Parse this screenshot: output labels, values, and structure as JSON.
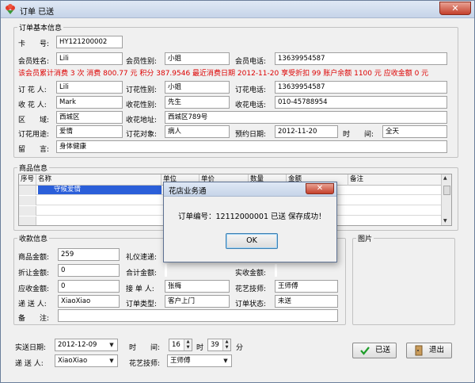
{
  "window": {
    "title": "订单 已送",
    "close": "✕"
  },
  "basic": {
    "title": "订单基本信息",
    "card_label": "卡　　号:",
    "card": "HY121200002",
    "mname_label": "会员姓名:",
    "mname": "Lili",
    "mgender_label": "会员性别:",
    "mgender": "小姐",
    "mphone_label": "会员电话:",
    "mphone": "13639954587",
    "summary": "该会员累计消费 3 次 消费 800.77 元 积分 387.9546 最近消费日期 2012-11-20 享受折扣 99 账户余额 1100 元 应收金额 0 元",
    "buyer_label": "订 花 人:",
    "buyer": "Lili",
    "bgender_label": "订花性别:",
    "bgender": "小姐",
    "bphone_label": "订花电话:",
    "bphone": "13639954587",
    "receiver_label": "收 花 人:",
    "receiver": "Mark",
    "rgender_label": "收花性别:",
    "rgender": "先生",
    "rphone_label": "收花电话:",
    "rphone": "010-45788954",
    "area_label": "区　　域:",
    "area": "西城区",
    "addr_label": "收花地址:",
    "addr": "西城区789号",
    "usage_label": "订花用途:",
    "usage": "爱情",
    "target_label": "订花对象:",
    "target": "病人",
    "date_label": "预约日期:",
    "date": "2012-11-20",
    "time_label": "时　　间:",
    "time": "全天",
    "msg_label": "留　　言:",
    "msg": "身体健康"
  },
  "goods": {
    "title": "商品信息",
    "columns": [
      "序号",
      "名称",
      "单位",
      "单价",
      "数量",
      "金额",
      "备注"
    ],
    "selected_item": "守候爱情"
  },
  "payment": {
    "title": "收款信息",
    "goods_amt_label": "商品金额:",
    "goods_amt": "259",
    "ceremony_label": "礼仪速递:",
    "discount_label": "折让金额:",
    "discount": "0",
    "total_label": "合计金额:",
    "total": "256.41",
    "received_label": "实收金额:",
    "received": "256.41",
    "due_label": "应收金额:",
    "due": "0",
    "handler_label": "接 单 人:",
    "handler": "张梅",
    "florist_label": "花艺技师:",
    "florist": "王师傅",
    "courier_label": "递 送 人:",
    "courier": "XiaoXiao",
    "otype_label": "订单类型:",
    "otype": "客户上门",
    "ostatus_label": "订单状态:",
    "ostatus": "未送",
    "note_label": "备　　注:",
    "note": ""
  },
  "picture": {
    "title": "图片"
  },
  "bottom": {
    "ship_date_label": "实送日期:",
    "ship_date": "2012-12-09",
    "time_label": "时　　间:",
    "hour": "16",
    "hour_unit": "时",
    "minute": "39",
    "minute_unit": "分",
    "courier_label": "递 送 人:",
    "courier": "XiaoXiao",
    "florist_label": "花艺技师:",
    "florist": "王师傅"
  },
  "buttons": {
    "sent": "已送",
    "exit": "退出"
  },
  "dialog": {
    "title": "花店业务通",
    "message": "订单编号：12112000001 已送 保存成功！",
    "ok": "OK",
    "close": "✕"
  },
  "colors": {
    "summary_text": "#dd0000",
    "selection": "#2b5fd9",
    "close_red": "#c4402b"
  },
  "icons": [
    "flower-app-icon",
    "check-icon",
    "exit-icon",
    "dropdown-arrow-icon",
    "spin-arrows-icon"
  ]
}
